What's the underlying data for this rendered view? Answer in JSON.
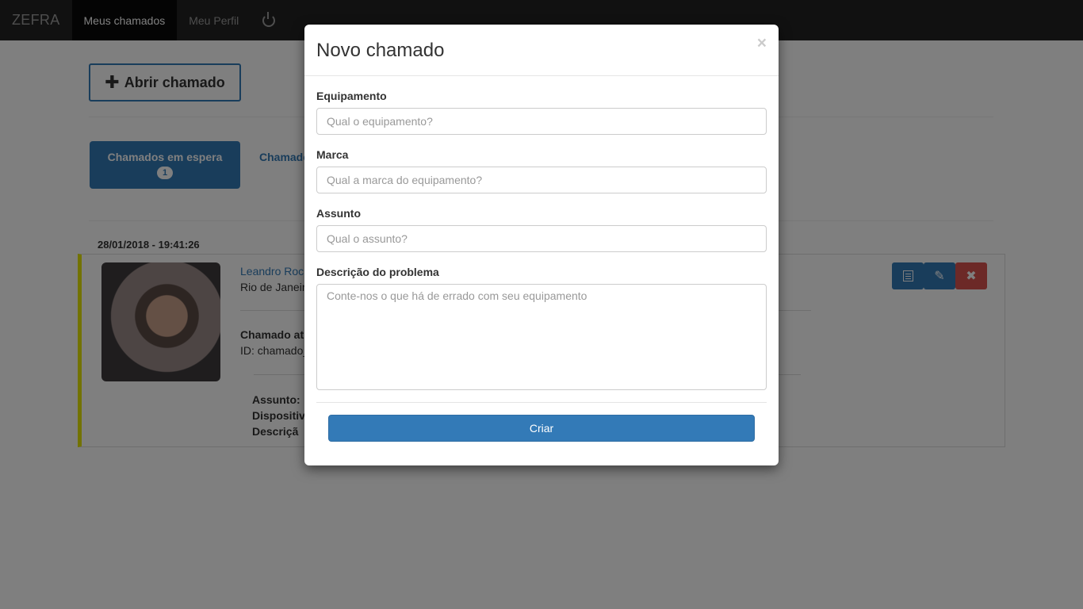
{
  "navbar": {
    "brand": "ZEFRA",
    "items": [
      {
        "label": "Meus chamados",
        "active": true
      },
      {
        "label": "Meu Perfil",
        "active": false
      }
    ],
    "power_icon": "power-icon"
  },
  "page": {
    "open_button_label": "Abrir chamado",
    "tabs": [
      {
        "label": "Chamados em espera",
        "badge": "1",
        "active": true
      },
      {
        "label": "Chamado",
        "active": false
      }
    ],
    "ticket": {
      "date": "28/01/2018 - 19:41:26",
      "user_name": "Leandro Roc",
      "user_city": "Rio de Janeir",
      "status": "Chamado at",
      "id_text": "ID: chamado_",
      "fields": [
        "Assunto:",
        "Dispositiv",
        "Descriçã"
      ]
    }
  },
  "modal": {
    "title": "Novo chamado",
    "close_symbol": "×",
    "fields": [
      {
        "label": "Equipamento",
        "placeholder": "Qual o equipamento?"
      },
      {
        "label": "Marca",
        "placeholder": "Qual a marca do equipamento?"
      },
      {
        "label": "Assunto",
        "placeholder": "Qual o assunto?"
      },
      {
        "label": "Descrição do problema",
        "placeholder": "Conte-nos o que há de errado com seu equipamento"
      }
    ],
    "submit_label": "Criar"
  },
  "colors": {
    "primary": "#337ab7",
    "danger": "#d9534f",
    "navbar": "#222222",
    "accent_border": "#e6e600"
  }
}
